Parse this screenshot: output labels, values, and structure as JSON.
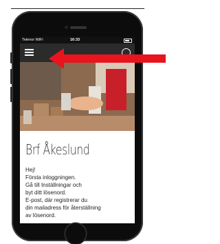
{
  "status_bar": {
    "carrier": "Telenor WiFi",
    "time": "16:33"
  },
  "main": {
    "title": "Brf Åkeslund",
    "body_lines": [
      "Hej!",
      "Första inloggningen.",
      "Gå till Inställningar och",
      "byt ditt lösenord.",
      "E-post, där registrerar du",
      "din mailadress för återställning",
      "av lösenord."
    ]
  },
  "colors": {
    "arrow": "#e8141e",
    "header": "#2b2b2b",
    "phone": "#0c0c0c"
  },
  "icons": [
    "menu-icon",
    "user-login-icon",
    "battery-icon",
    "red-arrow"
  ]
}
